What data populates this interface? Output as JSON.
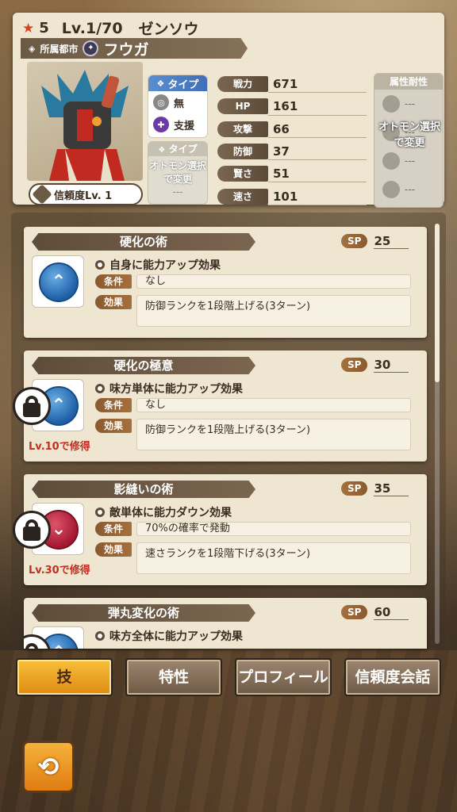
{
  "header": {
    "rarity": "5",
    "level": "Lv.1/70",
    "name": "ゼンソウ",
    "city_label": "所属都市",
    "city_name": "フウガ",
    "trust": "信頼度Lv.  1",
    "type_label": "タイプ",
    "type_values": [
      "無",
      "支援"
    ],
    "type2_label": "タイプ",
    "type2_text": "オトモン選択で変更",
    "type2_dash": "---",
    "stats": [
      {
        "label": "戦力",
        "value": "671"
      },
      {
        "label": "HP",
        "value": "161"
      },
      {
        "label": "攻撃",
        "value": "66"
      },
      {
        "label": "防御",
        "value": "37"
      },
      {
        "label": "賢さ",
        "value": "51"
      },
      {
        "label": "速さ",
        "value": "101"
      }
    ],
    "resist_label": "属性耐性",
    "resist_overlay": "オトモン選択で変更",
    "resist_dashes": [
      "---",
      "---",
      "---",
      "---"
    ]
  },
  "skills": [
    {
      "name": "硬化の術",
      "sp_label": "SP",
      "sp": "25",
      "desc": "自身に能力アップ効果",
      "cond_label": "条件",
      "cond": "なし",
      "eff_label": "効果",
      "effect": "防御ランクを1段階上げる(3ターン)",
      "icon_color": "blue",
      "locked": false,
      "unlock": ""
    },
    {
      "name": "硬化の極意",
      "sp_label": "SP",
      "sp": "30",
      "desc": "味方単体に能力アップ効果",
      "cond_label": "条件",
      "cond": "なし",
      "eff_label": "効果",
      "effect": "防御ランクを1段階上げる(3ターン)",
      "icon_color": "blue",
      "locked": true,
      "unlock": "Lv.10で修得"
    },
    {
      "name": "影縫いの術",
      "sp_label": "SP",
      "sp": "35",
      "desc": "敵単体に能力ダウン効果",
      "cond_label": "条件",
      "cond": "70%の確率で発動",
      "eff_label": "効果",
      "effect": "速さランクを1段階下げる(3ターン)",
      "icon_color": "red",
      "locked": true,
      "unlock": "Lv.30で修得"
    },
    {
      "name": "弾丸変化の術",
      "sp_label": "SP",
      "sp": "60",
      "desc": "味方全体に能力アップ効果",
      "icon_color": "blue",
      "locked": true
    }
  ],
  "tabs": [
    "技",
    "特性",
    "プロフィール",
    "信頼度会話"
  ],
  "colors": {
    "accent": "#e08a12",
    "lock_text": "#c03020"
  }
}
